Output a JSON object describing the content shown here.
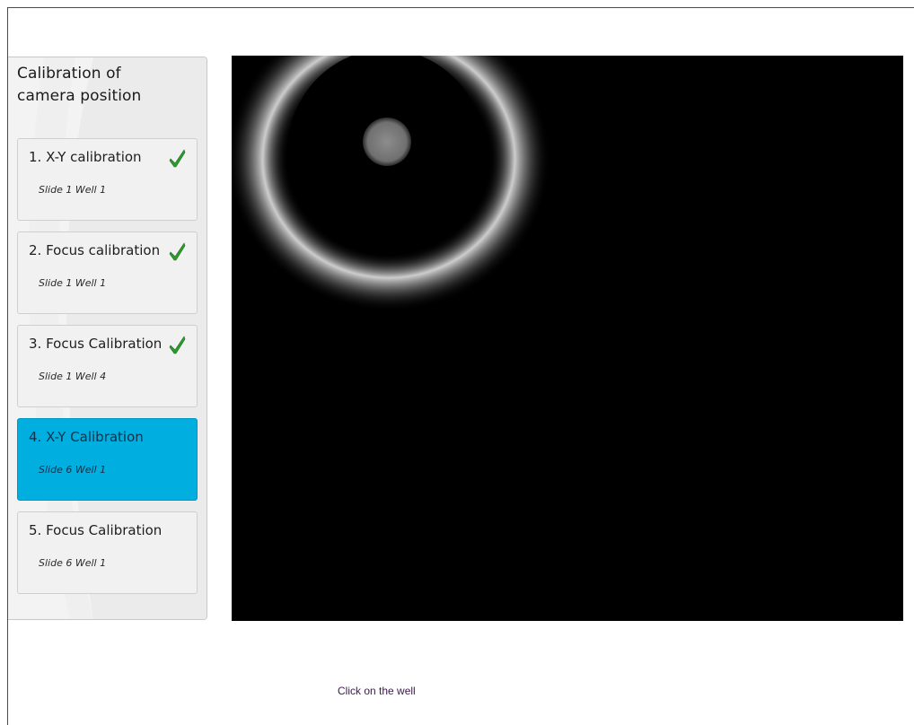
{
  "sidebar": {
    "title_line1": "Calibration of",
    "title_line2": "camera position",
    "steps": [
      {
        "label": "1. X-Y calibration",
        "location": "Slide 1 Well 1",
        "completed": true,
        "active": false
      },
      {
        "label": "2. Focus calibration",
        "location": "Slide 1 Well 1",
        "completed": true,
        "active": false
      },
      {
        "label": "3. Focus Calibration",
        "location": "Slide 1 Well 4",
        "completed": true,
        "active": false
      },
      {
        "label": "4. X-Y Calibration",
        "location": "Slide 6 Well 1",
        "completed": false,
        "active": true
      },
      {
        "label": "5. Focus Calibration",
        "location": "Slide 6 Well 1",
        "completed": false,
        "active": false
      }
    ]
  },
  "camera": {
    "background_color": "#000000"
  },
  "status": {
    "message": "Click on the well"
  },
  "colors": {
    "active_step": "#00aee0",
    "check_green": "#2e9a2e",
    "sidebar_bg": "#f3f3f3"
  },
  "icons": {
    "completed": "checkmark-icon"
  }
}
